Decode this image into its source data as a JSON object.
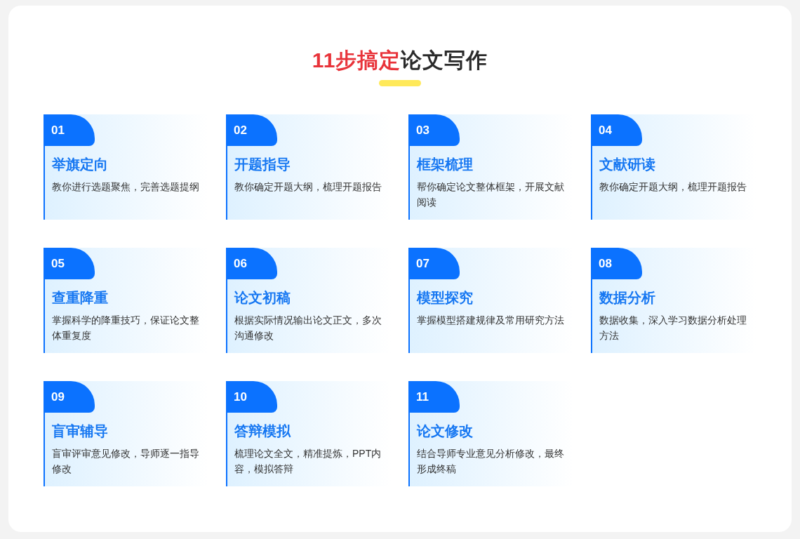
{
  "title": {
    "highlight": "11步搞定",
    "rest": "论文写作"
  },
  "steps": [
    {
      "number": "01",
      "title": "举旗定向",
      "description": "教你进行选题聚焦，完善选题提纲"
    },
    {
      "number": "02",
      "title": "开题指导",
      "description": "教你确定开题大纲，梳理开题报告"
    },
    {
      "number": "03",
      "title": "框架梳理",
      "description": "帮你确定论文整体框架，开展文献阅读"
    },
    {
      "number": "04",
      "title": "文献研读",
      "description": "教你确定开题大纲，梳理开题报告"
    },
    {
      "number": "05",
      "title": "查重降重",
      "description": "掌握科学的降重技巧，保证论文整体重复度"
    },
    {
      "number": "06",
      "title": "论文初稿",
      "description": "根据实际情况输出论文正文，多次沟通修改"
    },
    {
      "number": "07",
      "title": "模型探究",
      "description": "掌握模型搭建规律及常用研究方法"
    },
    {
      "number": "08",
      "title": "数据分析",
      "description": "数据收集，深入学习数据分析处理方法"
    },
    {
      "number": "09",
      "title": "盲审辅导",
      "description": "盲审评审意见修改，导师逐一指导修改"
    },
    {
      "number": "10",
      "title": "答辩模拟",
      "description": "梳理论文全文，精准提炼，PPT内容，模拟答辩"
    },
    {
      "number": "11",
      "title": "论文修改",
      "description": "结合导师专业意见分析修改，最终形成终稿"
    }
  ]
}
